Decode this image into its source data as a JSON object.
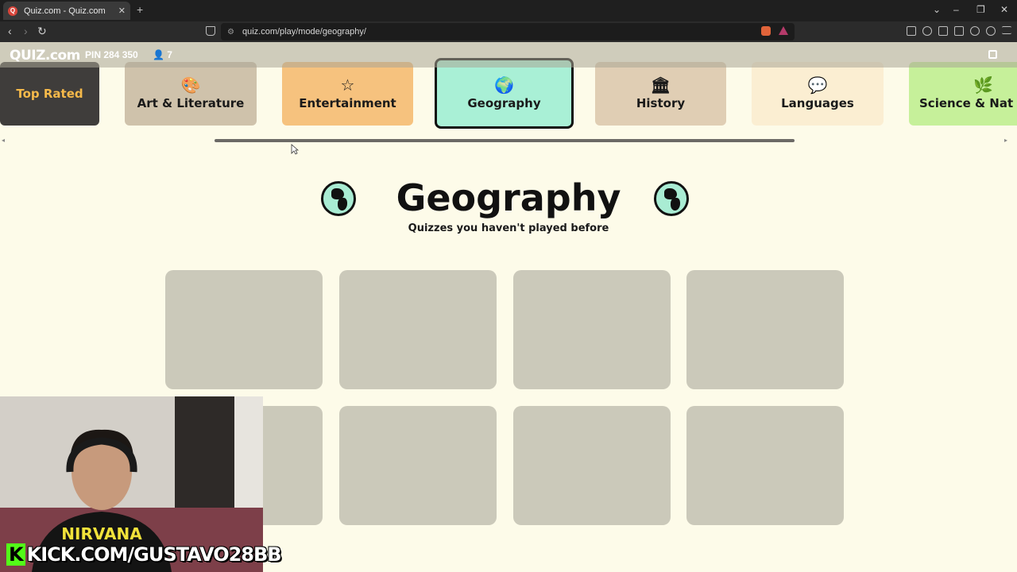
{
  "browser": {
    "tab_title": "Quiz.com - Quiz.com",
    "tab_close": "✕",
    "new_tab": "+",
    "url": "quiz.com/play/mode/geography/",
    "back": "‹",
    "forward": "›",
    "reload": "↻",
    "win_minimize": "–",
    "win_restore": "❐",
    "win_close": "✕",
    "win_dropdown": "⌄"
  },
  "gamebar": {
    "logo": "QUIZ.com",
    "pin": "PIN 284 350",
    "players": "👤 7"
  },
  "categories": [
    {
      "label": "Top Rated",
      "icon": "",
      "color": "#3f3d3b"
    },
    {
      "label": "Art & Literature",
      "icon": "🎨",
      "color": "#cfc2ab"
    },
    {
      "label": "Entertainment",
      "icon": "☆",
      "color": "#f6c27e"
    },
    {
      "label": "Geography",
      "icon": "🌍",
      "color": "#a9f0d6",
      "active": true
    },
    {
      "label": "History",
      "icon": "🏛",
      "color": "#e0ceb4"
    },
    {
      "label": "Languages",
      "icon": "💬",
      "color": "#fbeed2"
    },
    {
      "label": "Science & Nat",
      "icon": "🌿",
      "color": "#c6f09a"
    }
  ],
  "heading": {
    "title": "Geography",
    "subtitle": "Quizzes you haven't played before"
  },
  "webcam": {
    "overlay_text": "KICK.COM/GUSTAVO28BB",
    "badge": "K"
  }
}
